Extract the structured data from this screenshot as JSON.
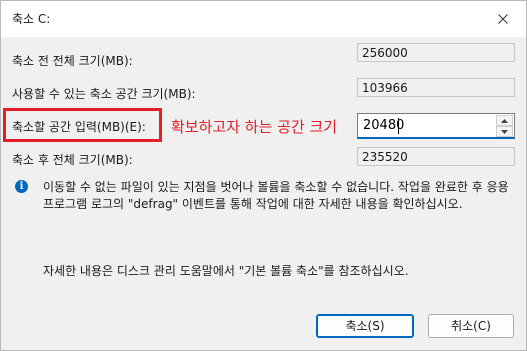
{
  "window": {
    "title": "축소 C:",
    "close_glyph": "✕"
  },
  "rows": {
    "total_before": {
      "label": "축소 전 전체 크기(MB):",
      "value": "256000"
    },
    "available": {
      "label": "사용할 수 있는 축소 공간 크기(MB):",
      "value": "103966"
    },
    "shrink_amount": {
      "label": "축소할 공간 입력(MB)(E):",
      "value": "20480"
    },
    "total_after": {
      "label": "축소 후 전체 크기(MB):",
      "value": "235520"
    }
  },
  "annotation": {
    "text": "확보하고자 하는 공간 크기",
    "color": "#e41e26"
  },
  "info": {
    "icon": "info-icon",
    "text": "이동할 수 없는 파일이 있는 지점을 벗어나 볼륨을 축소할 수 없습니다. 작업을 완료한 후 응용 프로그램 로그의 \"defrag\" 이벤트를 통해 작업에 대한 자세한 내용을 확인하십시오."
  },
  "help": {
    "text": "자세한 내용은 디스크 관리 도움말에서 \"기본 볼륨 축소\"를 참조하십시오."
  },
  "buttons": {
    "ok": "축소(S)",
    "cancel": "취소(C)"
  },
  "colors": {
    "accent": "#0067c0",
    "highlight": "#e41e26"
  }
}
